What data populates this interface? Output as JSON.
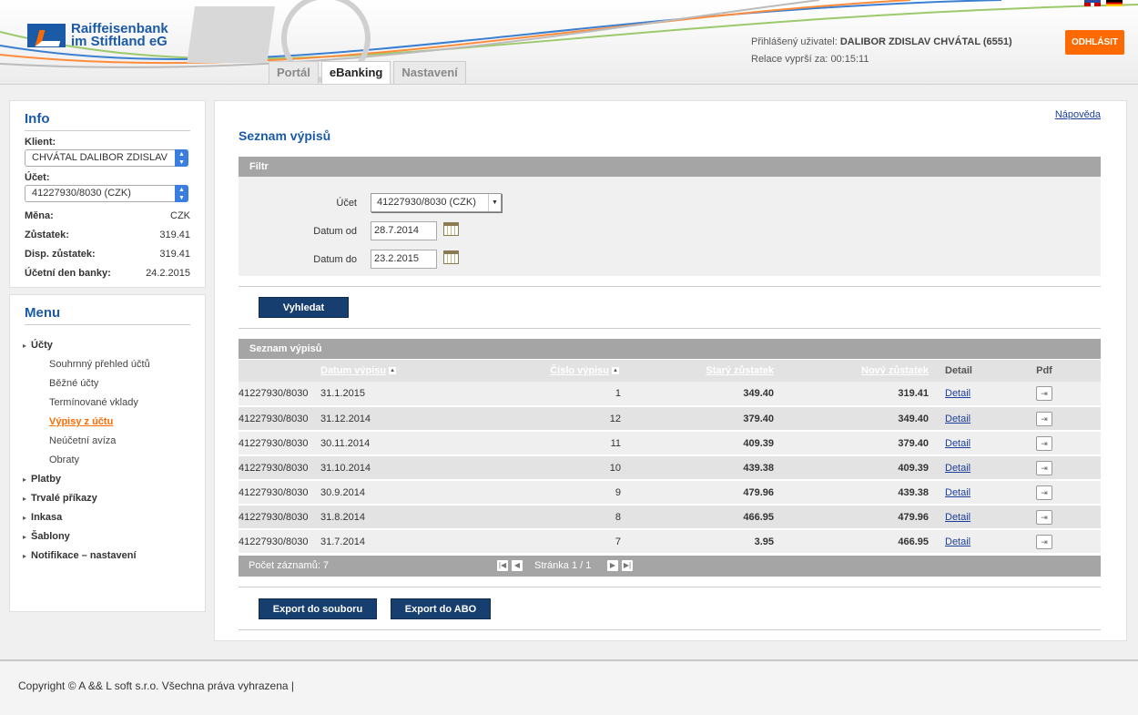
{
  "brand": {
    "line1": "Raiffeisenbank",
    "line2": "im Stiftland eG"
  },
  "tabs": [
    {
      "label": "Portál"
    },
    {
      "label": "eBanking"
    },
    {
      "label": "Nastavení"
    }
  ],
  "user": {
    "logged_label": "Přihlášený uživatel:",
    "name": "DALIBOR ZDISLAV CHVÁTAL (6551)",
    "session_label": "Relace vyprší za:",
    "session_time": "00:15:11",
    "logout_label": "ODHLÁSIT"
  },
  "info": {
    "title": "Info",
    "client_label": "Klient:",
    "client_value": "CHVÁTAL DALIBOR ZDISLAV",
    "account_label": "Účet:",
    "account_value": "41227930/8030 (CZK)",
    "rows": [
      {
        "key": "Měna:",
        "value": "CZK"
      },
      {
        "key": "Zůstatek:",
        "value": "319.41"
      },
      {
        "key": "Disp. zůstatek:",
        "value": "319.41"
      },
      {
        "key": "Účetní den banky:",
        "value": "24.2.2015"
      }
    ]
  },
  "menu": {
    "title": "Menu",
    "items": [
      {
        "label": "Účty"
      },
      {
        "label": "Souhrnný přehled účtů"
      },
      {
        "label": "Běžné účty"
      },
      {
        "label": "Termínované vklady"
      },
      {
        "label": "Výpisy z účtu"
      },
      {
        "label": "Neúčetní avíza"
      },
      {
        "label": "Obraty"
      },
      {
        "label": "Platby"
      },
      {
        "label": "Trvalé příkazy"
      },
      {
        "label": "Inkasa"
      },
      {
        "label": "Šablony"
      },
      {
        "label": "Notifikace – nastavení"
      }
    ]
  },
  "main": {
    "help_link": "Nápověda",
    "page_title": "Seznam výpisů",
    "filter": {
      "bar_title": "Filtr",
      "account_label": "Účet",
      "account_value": "41227930/8030 (CZK)",
      "date_from_label": "Datum od",
      "date_from_value": "28.7.2014",
      "date_to_label": "Datum do",
      "date_to_value": "23.2.2015",
      "search_button": "Vyhledat"
    },
    "list": {
      "bar_title": "Seznam výpisů",
      "columns": {
        "date": "Datum výpisu",
        "number": "Číslo výpisu",
        "old_balance": "Starý zůstatek",
        "new_balance": "Nový zůstatek",
        "detail": "Detail",
        "pdf": "Pdf"
      },
      "rows": [
        {
          "account": "41227930/8030",
          "date": "31.1.2015",
          "number": "1",
          "old": "349.40",
          "new": "319.41",
          "detail": "Detail"
        },
        {
          "account": "41227930/8030",
          "date": "31.12.2014",
          "number": "12",
          "old": "379.40",
          "new": "349.40",
          "detail": "Detail"
        },
        {
          "account": "41227930/8030",
          "date": "30.11.2014",
          "number": "11",
          "old": "409.39",
          "new": "379.40",
          "detail": "Detail"
        },
        {
          "account": "41227930/8030",
          "date": "31.10.2014",
          "number": "10",
          "old": "439.38",
          "new": "409.39",
          "detail": "Detail"
        },
        {
          "account": "41227930/8030",
          "date": "30.9.2014",
          "number": "9",
          "old": "479.96",
          "new": "439.38",
          "detail": "Detail"
        },
        {
          "account": "41227930/8030",
          "date": "31.8.2014",
          "number": "8",
          "old": "466.95",
          "new": "479.96",
          "detail": "Detail"
        },
        {
          "account": "41227930/8030",
          "date": "31.7.2014",
          "number": "7",
          "old": "3.95",
          "new": "466.95",
          "detail": "Detail"
        }
      ],
      "record_count": "Počet záznamů: 7",
      "page_info": "Stránka 1 / 1"
    },
    "export_file_button": "Export do souboru",
    "export_abo_button": "Export do ABO"
  },
  "footer": {
    "text": "Copyright © A && L soft s.r.o. Všechna práva vyhrazena |"
  },
  "colors": {
    "brand_blue": "#1b5aa6",
    "accent_orange": "#ff6a00",
    "button_navy": "#163e6e",
    "bar_gray": "#a5a5a5"
  }
}
